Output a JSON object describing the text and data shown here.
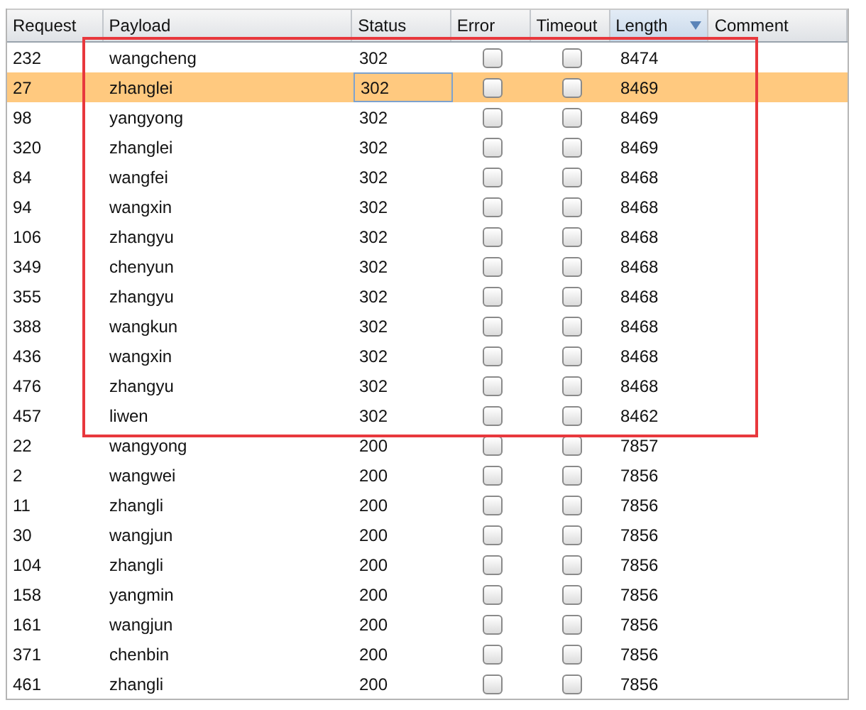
{
  "table": {
    "columns": [
      {
        "label": "Request",
        "sorted": false
      },
      {
        "label": "Payload",
        "sorted": false
      },
      {
        "label": "Status",
        "sorted": false
      },
      {
        "label": "Error",
        "sorted": false
      },
      {
        "label": "Timeout",
        "sorted": false
      },
      {
        "label": "Length",
        "sorted": true
      },
      {
        "label": "Comment",
        "sorted": false
      }
    ],
    "rows": [
      {
        "request": "232",
        "payload": "wangcheng",
        "status": "302",
        "error": false,
        "timeout": false,
        "length": "8474",
        "selected": false
      },
      {
        "request": "27",
        "payload": "zhanglei",
        "status": "302",
        "error": false,
        "timeout": false,
        "length": "8469",
        "selected": true
      },
      {
        "request": "98",
        "payload": "yangyong",
        "status": "302",
        "error": false,
        "timeout": false,
        "length": "8469",
        "selected": false
      },
      {
        "request": "320",
        "payload": "zhanglei",
        "status": "302",
        "error": false,
        "timeout": false,
        "length": "8469",
        "selected": false
      },
      {
        "request": "84",
        "payload": "wangfei",
        "status": "302",
        "error": false,
        "timeout": false,
        "length": "8468",
        "selected": false
      },
      {
        "request": "94",
        "payload": "wangxin",
        "status": "302",
        "error": false,
        "timeout": false,
        "length": "8468",
        "selected": false
      },
      {
        "request": "106",
        "payload": "zhangyu",
        "status": "302",
        "error": false,
        "timeout": false,
        "length": "8468",
        "selected": false
      },
      {
        "request": "349",
        "payload": "chenyun",
        "status": "302",
        "error": false,
        "timeout": false,
        "length": "8468",
        "selected": false
      },
      {
        "request": "355",
        "payload": "zhangyu",
        "status": "302",
        "error": false,
        "timeout": false,
        "length": "8468",
        "selected": false
      },
      {
        "request": "388",
        "payload": "wangkun",
        "status": "302",
        "error": false,
        "timeout": false,
        "length": "8468",
        "selected": false
      },
      {
        "request": "436",
        "payload": "wangxin",
        "status": "302",
        "error": false,
        "timeout": false,
        "length": "8468",
        "selected": false
      },
      {
        "request": "476",
        "payload": "zhangyu",
        "status": "302",
        "error": false,
        "timeout": false,
        "length": "8468",
        "selected": false
      },
      {
        "request": "457",
        "payload": "liwen",
        "status": "302",
        "error": false,
        "timeout": false,
        "length": "8462",
        "selected": false
      },
      {
        "request": "22",
        "payload": "wangyong",
        "status": "200",
        "error": false,
        "timeout": false,
        "length": "7857",
        "selected": false
      },
      {
        "request": "2",
        "payload": "wangwei",
        "status": "200",
        "error": false,
        "timeout": false,
        "length": "7856",
        "selected": false
      },
      {
        "request": "11",
        "payload": "zhangli",
        "status": "200",
        "error": false,
        "timeout": false,
        "length": "7856",
        "selected": false
      },
      {
        "request": "30",
        "payload": "wangjun",
        "status": "200",
        "error": false,
        "timeout": false,
        "length": "7856",
        "selected": false
      },
      {
        "request": "104",
        "payload": "zhangli",
        "status": "200",
        "error": false,
        "timeout": false,
        "length": "7856",
        "selected": false
      },
      {
        "request": "158",
        "payload": "yangmin",
        "status": "200",
        "error": false,
        "timeout": false,
        "length": "7856",
        "selected": false
      },
      {
        "request": "161",
        "payload": "wangjun",
        "status": "200",
        "error": false,
        "timeout": false,
        "length": "7856",
        "selected": false
      },
      {
        "request": "371",
        "payload": "chenbin",
        "status": "200",
        "error": false,
        "timeout": false,
        "length": "7856",
        "selected": false
      },
      {
        "request": "461",
        "payload": "zhangli",
        "status": "200",
        "error": false,
        "timeout": false,
        "length": "7856",
        "selected": false
      }
    ]
  }
}
